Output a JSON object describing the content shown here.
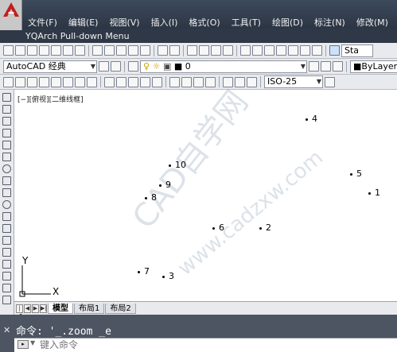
{
  "app": {
    "title": "YQArch Pull-down Menu"
  },
  "menu": {
    "items": [
      "文件(F)",
      "编辑(E)",
      "视图(V)",
      "插入(I)",
      "格式(O)",
      "工具(T)",
      "绘图(D)",
      "标注(N)",
      "修改(M)"
    ]
  },
  "toolbar1": {
    "right_label": "Sta"
  },
  "toolbar2": {
    "workspace": "AutoCAD 经典",
    "layer": "0",
    "bylayer": "ByLayer"
  },
  "toolbar3": {
    "dimstyle": "ISO-25"
  },
  "canvas": {
    "view_label": "[−][俯视][二维线框]",
    "points": [
      {
        "label": "1"
      },
      {
        "label": "2"
      },
      {
        "label": "3"
      },
      {
        "label": "4"
      },
      {
        "label": "5"
      },
      {
        "label": "6"
      },
      {
        "label": "7"
      },
      {
        "label": "8"
      },
      {
        "label": "9"
      },
      {
        "label": "10"
      }
    ],
    "axis_x": "X",
    "axis_y": "Y",
    "watermark1": "CAD自学网",
    "watermark2": "www.cadzxw.com"
  },
  "tabs": {
    "items": [
      "模型",
      "布局1",
      "布局2"
    ],
    "active": "模型"
  },
  "command": {
    "history": "命令: '_.zoom _e",
    "placeholder": "键入命令"
  }
}
